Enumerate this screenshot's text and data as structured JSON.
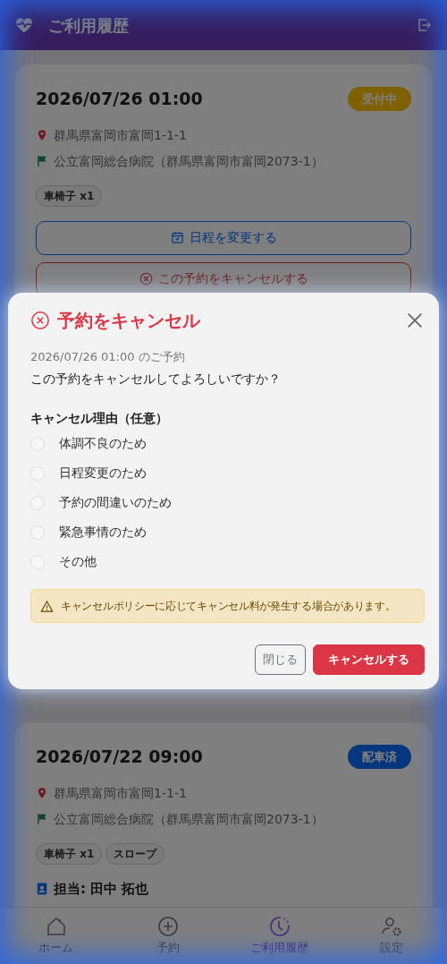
{
  "header": {
    "title": "ご利用履歴"
  },
  "bookings": [
    {
      "datetime": "2026/07/26 01:00",
      "status": {
        "label": "受付中",
        "kind": "pending"
      },
      "pickup": "群馬県富岡市富岡1-1-1",
      "destination": "公立富岡総合病院（群馬県富岡市富岡2073-1）",
      "tags": [
        "車椅子 x1"
      ],
      "actions": [
        {
          "label": "日程を変更する",
          "kind": "reschedule"
        },
        {
          "label": "この予約をキャンセルする",
          "kind": "cancel"
        }
      ]
    },
    {
      "datetime": "2026/07/22 09:00",
      "status": {
        "label": "配車済",
        "kind": "dispatched"
      },
      "pickup": "群馬県富岡市富岡1-1-1",
      "destination": "公立富岡総合病院（群馬県富岡市富岡2073-1）",
      "tags": [
        "車椅子 x1",
        "スロープ"
      ],
      "driver": "担当: 田中 拓也"
    }
  ],
  "bottom_nav": [
    {
      "label": "ホーム",
      "kind": "home",
      "selected": false
    },
    {
      "label": "予約",
      "kind": "add",
      "selected": false
    },
    {
      "label": "ご利用履歴",
      "kind": "history",
      "selected": true
    },
    {
      "label": "設定",
      "kind": "settings",
      "selected": false
    }
  ],
  "modal": {
    "title": "予約をキャンセル",
    "booking_ref": "2026/07/26 01:00 のご予約",
    "question": "この予約をキャンセルしてよろしいですか？",
    "reason_label": "キャンセル理由（任意）",
    "reasons": [
      {
        "label": "体調不良のため",
        "selected": false
      },
      {
        "label": "日程変更のため",
        "selected": false
      },
      {
        "label": "予約の間違いのため",
        "selected": false
      },
      {
        "label": "緊急事情のため",
        "selected": false
      },
      {
        "label": "その他",
        "selected": false
      }
    ],
    "warning": "キャンセルポリシーに応じてキャンセル料が発生する場合があります。",
    "buttons": [
      {
        "label": "閉じる",
        "kind": "close"
      },
      {
        "label": "キャンセルする",
        "kind": "confirm"
      }
    ]
  }
}
